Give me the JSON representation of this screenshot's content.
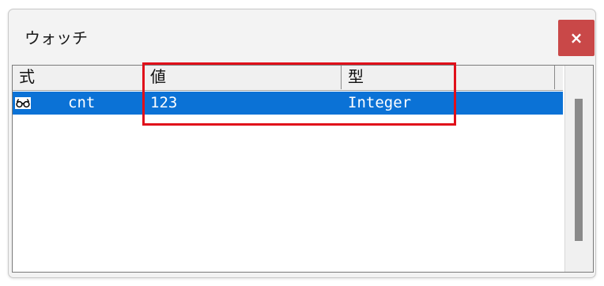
{
  "window": {
    "title": "ウォッチ",
    "close_label": "×"
  },
  "columns": {
    "expression": "式",
    "value": "値",
    "type": "型"
  },
  "rows": [
    {
      "icon": "glasses-icon",
      "expression": "cnt",
      "value": "123",
      "type": "Integer",
      "selected": true
    }
  ],
  "colors": {
    "selection": "#0b72d6",
    "close_button": "#c94848",
    "highlight_box": "#e0101a"
  }
}
